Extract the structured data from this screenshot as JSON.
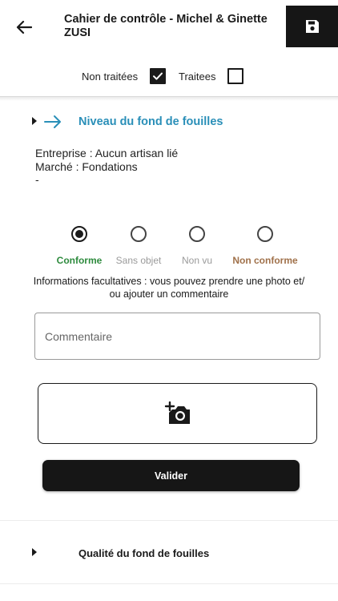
{
  "header": {
    "title": "Cahier de contrôle - Michel & Ginette ZUSI"
  },
  "filters": {
    "untreated_label": "Non traitées",
    "untreated_checked": true,
    "treated_label": "Traitees",
    "treated_checked": false
  },
  "section": {
    "title": "Niveau du fond de fouilles",
    "title_color": "#2a8fb8",
    "info_lines": [
      "Entreprise : Aucun artisan lié",
      "Marché : Fondations",
      "-"
    ]
  },
  "status_options": [
    {
      "label": "Conforme",
      "color": "#2e8b3e",
      "selected": true
    },
    {
      "label": "Sans objet",
      "color": "#9a9a9a",
      "selected": false
    },
    {
      "label": "Non vu",
      "color": "#9a9a9a",
      "selected": false
    },
    {
      "label": "Non conforme",
      "color": "#a0714a",
      "selected": false
    }
  ],
  "help_text": "Informations facultatives : vous pouvez prendre une photo et/ ou ajouter un commentaire",
  "comment": {
    "placeholder": "Commentaire",
    "value": ""
  },
  "photo": {
    "icon": "add-photo-icon"
  },
  "validate_label": "Valider",
  "next_section": {
    "title": "Qualité du fond de fouilles"
  }
}
